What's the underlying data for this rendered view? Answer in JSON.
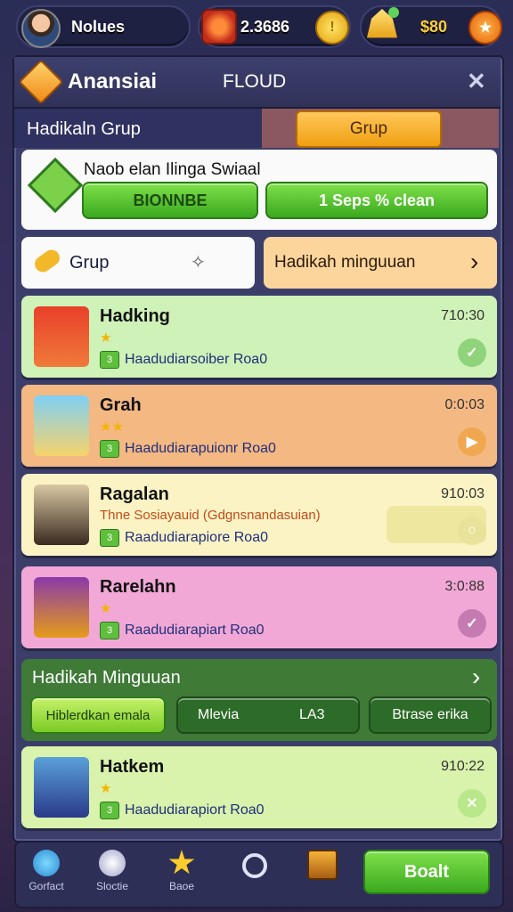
{
  "topbar": {
    "username": "Nolues",
    "coins": "2.3686",
    "gems": "$80",
    "avatar_icon": "player-avatar",
    "coin_icon": "coin-icon"
  },
  "panel": {
    "title": "Anansiai",
    "subtitle": "FLOUD",
    "close": "✕",
    "tab_left": "Hadikaln Grup",
    "tab_right": "Grup"
  },
  "task": {
    "title": "Naob elan Ilinga Swiaal",
    "btn_left": "BIONNBE",
    "btn_right": "1 Seps % clean"
  },
  "filters": {
    "group": "Grup",
    "weekly": "Hadikah minguuan",
    "arrow": "›"
  },
  "rows": [
    {
      "name": "Hadking",
      "stars": "★",
      "line": "Haadudiarsoiber Roa0",
      "time": "710:30",
      "bg": "#cff2b8",
      "check": "✓"
    },
    {
      "name": "Grah",
      "stars": "★★",
      "line": "Haadudiarapuionr Roa0",
      "time": "0:0:03",
      "bg": "#f4b883",
      "check": "▶"
    },
    {
      "name": "Ragalan",
      "stars": "",
      "extra": "Thne Sosiayauid (Gdgnsnandasuian)",
      "line": "Raadudiarapiore Roa0",
      "time": "910:03",
      "bg": "#fbf3c4",
      "check": "○"
    },
    {
      "name": "Rarelahn",
      "stars": "★",
      "line": "Raadudiarapiart Roa0",
      "time": "3:0:88",
      "bg": "#f2a8d6",
      "check": "✓"
    },
    {
      "name": "Hatkem",
      "stars": "★",
      "line": "Haadudiarapiort Roa0",
      "time": "910:22",
      "bg": "#d9f2ac",
      "check": "✕"
    }
  ],
  "weekly_section": {
    "title": "Hadikah Minguuan",
    "arrow": "›",
    "btn1": "Hiblerdkan emala",
    "btn2a": "Mlevia",
    "btn2b": "LA3",
    "btn3": "Btrase erika"
  },
  "nav": {
    "items": [
      "Gorfact",
      "Sloctie",
      "Baoe",
      "",
      ""
    ],
    "cta": "Boalt"
  },
  "colors": {
    "accent_green": "#3aa91f",
    "accent_orange": "#f5a623",
    "panel": "#3c3e6a"
  }
}
